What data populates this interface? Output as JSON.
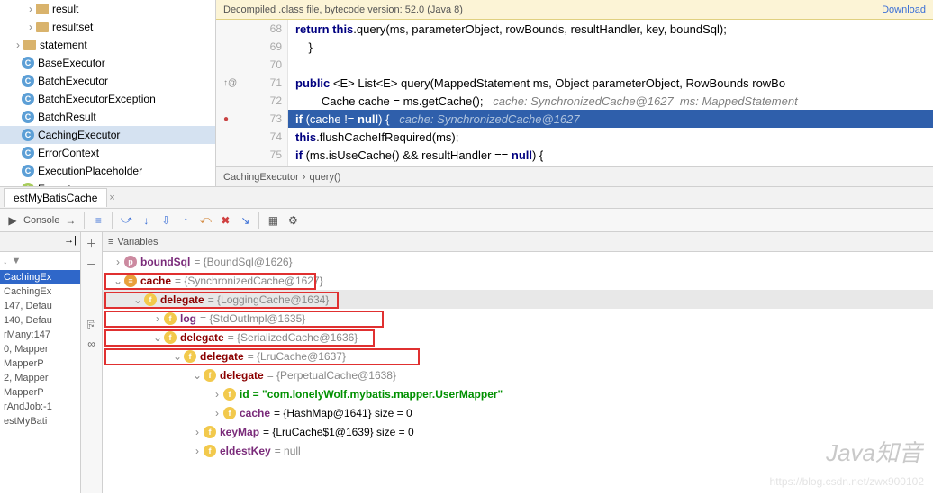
{
  "banner": {
    "text": "Decompiled .class file, bytecode version: 52.0 (Java 8)",
    "link": "Download"
  },
  "tree": [
    {
      "type": "folder",
      "label": "result",
      "indent": 28,
      "tw": "›"
    },
    {
      "type": "folder",
      "label": "resultset",
      "indent": 28,
      "tw": "›"
    },
    {
      "type": "folder",
      "label": "statement",
      "indent": 14,
      "tw": "›"
    },
    {
      "type": "class",
      "label": "BaseExecutor",
      "indent": 24,
      "icon": "c"
    },
    {
      "type": "class",
      "label": "BatchExecutor",
      "indent": 24,
      "icon": "c"
    },
    {
      "type": "class",
      "label": "BatchExecutorException",
      "indent": 24,
      "icon": "c"
    },
    {
      "type": "class",
      "label": "BatchResult",
      "indent": 24,
      "icon": "c"
    },
    {
      "type": "class",
      "label": "CachingExecutor",
      "indent": 24,
      "icon": "c",
      "sel": true
    },
    {
      "type": "class",
      "label": "ErrorContext",
      "indent": 24,
      "icon": "c"
    },
    {
      "type": "class",
      "label": "ExecutionPlaceholder",
      "indent": 24,
      "icon": "c"
    },
    {
      "type": "class",
      "label": "Executor",
      "indent": 24,
      "icon": "i"
    }
  ],
  "code": {
    "lines": [
      {
        "n": 68,
        "html": "        <span class='kw'>return this</span>.query(ms, parameterObject, rowBounds, resultHandler, key, boundSql);"
      },
      {
        "n": 69,
        "html": "    }"
      },
      {
        "n": 70,
        "html": ""
      },
      {
        "n": 71,
        "html": "    <span class='kw'>public</span> &lt;E&gt; List&lt;E&gt; query(MappedStatement ms, Object parameterObject, RowBounds rowBo",
        "gut": "↑@",
        "gutc": "#888"
      },
      {
        "n": 72,
        "html": "        Cache cache = ms.getCache();   <span class='cm'>cache: SynchronizedCache@1627  ms: MappedStatement</span>"
      },
      {
        "n": 73,
        "html": "        <span class='kw'>if</span> (cache != <span class='kw'>null</span>) {   <span class='cm'>cache: SynchronizedCache@1627</span>",
        "hl": true,
        "gut": "●",
        "gutc": "#c94444"
      },
      {
        "n": 74,
        "html": "            <span class='kw'>this</span>.flushCacheIfRequired(ms);"
      },
      {
        "n": 75,
        "html": "            <span class='kw'>if</span> (ms.isUseCache() && resultHandler == <span class='kw'>null</span>) {"
      }
    ]
  },
  "breadcrumb": [
    "CachingExecutor",
    "›",
    "query()"
  ],
  "tab": "estMyBatisCache",
  "toolbar_left": "Console",
  "frames": [
    "CachingEx",
    "CachingEx",
    "147, Defau",
    "140, Defau",
    "rMany:147",
    "0, Mapper",
    "MapperP",
    "2, Mapper",
    "MapperP",
    "rAndJob:-1",
    "estMyBati"
  ],
  "vars_title": "Variables",
  "vars": [
    {
      "ind": 0,
      "tw": "›",
      "ic": "p",
      "name": "boundSql",
      "val": "= {BoundSql@1626}",
      "nc": ""
    },
    {
      "ind": 0,
      "tw": "⌄",
      "ic": "",
      "name": "cache",
      "val": "= {SynchronizedCache@1627}",
      "nc": "red",
      "box": 1
    },
    {
      "ind": 1,
      "tw": "⌄",
      "ic": "f",
      "name": "delegate",
      "val": "= {LoggingCache@1634}",
      "nc": "red",
      "box": 2,
      "sel": true
    },
    {
      "ind": 2,
      "tw": "›",
      "ic": "f",
      "name": "log",
      "val": "= {StdOutImpl@1635}",
      "nc": ""
    },
    {
      "ind": 2,
      "tw": "⌄",
      "ic": "f",
      "name": "delegate",
      "val": "= {SerializedCache@1636}",
      "nc": "red",
      "box": 3
    },
    {
      "ind": 3,
      "tw": "⌄",
      "ic": "f",
      "name": "delegate",
      "val": "= {LruCache@1637}",
      "nc": "red",
      "box": 4
    },
    {
      "ind": 4,
      "tw": "⌄",
      "ic": "f",
      "name": "delegate",
      "val": "= {PerpetualCache@1638}",
      "nc": "red",
      "box": 5
    },
    {
      "ind": 5,
      "tw": "›",
      "ic": "f",
      "name": "id",
      "val": "= \"com.lonelyWolf.mybatis.mapper.UserMapper\"",
      "nc": "green",
      "vgreen": true
    },
    {
      "ind": 5,
      "tw": "›",
      "ic": "f",
      "name": "cache",
      "val": "= {HashMap@1641}  size = 0",
      "nc": ""
    },
    {
      "ind": 4,
      "tw": "›",
      "ic": "f",
      "name": "keyMap",
      "val": "= {LruCache$1@1639}  size = 0",
      "nc": ""
    },
    {
      "ind": 4,
      "tw": "›",
      "ic": "f",
      "name": "eldestKey",
      "val": "= null",
      "nc": ""
    }
  ],
  "watermark": "Java知音",
  "wm2": "https://blog.csdn.net/zwx900102"
}
